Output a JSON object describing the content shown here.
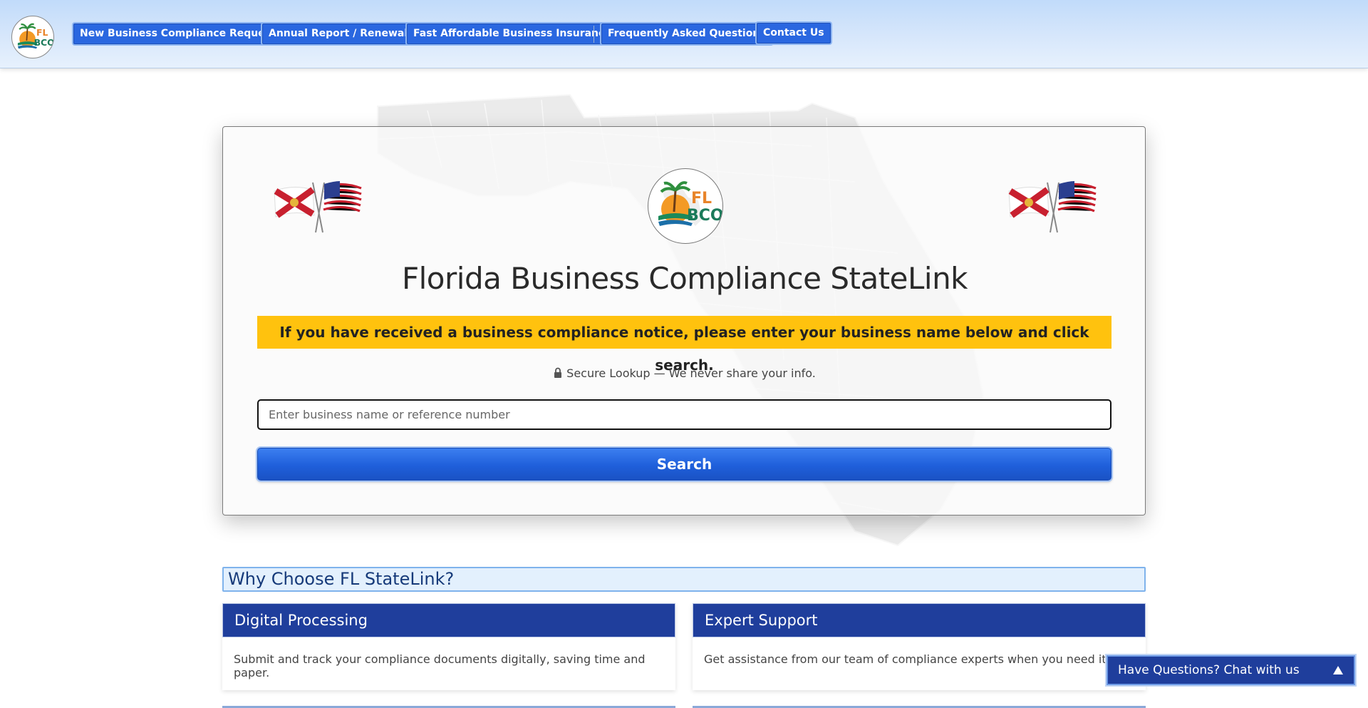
{
  "header": {
    "logo_text_top": "FL",
    "logo_text_bottom": "BCO",
    "nav": [
      {
        "label": "New Business Compliance Request"
      },
      {
        "label": "Annual Report / Renewals"
      },
      {
        "label": "Fast Affordable Business Insurance"
      },
      {
        "label": "Frequently Asked Questions"
      },
      {
        "label": "Contact Us"
      }
    ]
  },
  "card": {
    "logo_text_top": "FL",
    "logo_text_bottom": "BCO",
    "title": "Florida Business Compliance StateLink",
    "notice": "If you have received a business compliance notice, please enter your business name below and click search.",
    "secure_text": "Secure Lookup — We never share your info.",
    "search": {
      "placeholder": "Enter business name or reference number",
      "value": "",
      "button_label": "Search"
    }
  },
  "why": {
    "heading": "Why Choose FL StateLink?",
    "features": [
      {
        "title": "Digital Processing",
        "text": "Submit and track your compliance documents digitally, saving time and paper."
      },
      {
        "title": "Expert Support",
        "text": "Get assistance from our team of compliance experts when you need it."
      }
    ]
  },
  "chat": {
    "label": "Have Questions? Chat with us"
  },
  "colors": {
    "nav_button": "#2a67e0",
    "notice_bg": "#ffc20e",
    "search_button": "#1f5fdb",
    "feature_header": "#1f3e9c",
    "why_bg": "#e3f0fd"
  },
  "icons": [
    "lock-icon",
    "chevron-up-icon",
    "florida-flag-icon",
    "us-flag-icon"
  ]
}
